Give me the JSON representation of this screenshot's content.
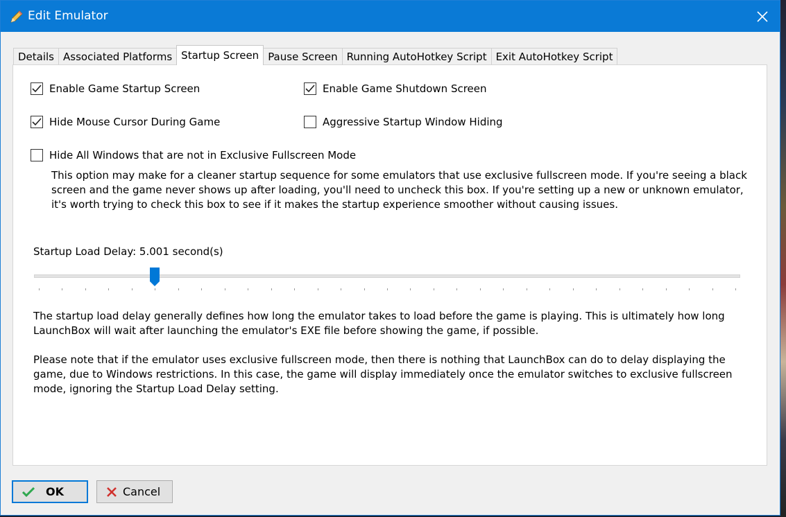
{
  "window": {
    "title": "Edit Emulator"
  },
  "tabs": [
    {
      "label": "Details"
    },
    {
      "label": "Associated Platforms"
    },
    {
      "label": "Startup Screen",
      "active": true
    },
    {
      "label": "Pause Screen"
    },
    {
      "label": "Running AutoHotkey Script"
    },
    {
      "label": "Exit AutoHotkey Script"
    }
  ],
  "startup": {
    "enable_startup": {
      "label": "Enable Game Startup Screen",
      "checked": true
    },
    "enable_shutdown": {
      "label": "Enable Game Shutdown Screen",
      "checked": true
    },
    "hide_cursor": {
      "label": "Hide Mouse Cursor During Game",
      "checked": true
    },
    "aggressive_hiding": {
      "label": "Aggressive Startup Window Hiding",
      "checked": false
    },
    "hide_windows": {
      "label": "Hide All Windows that are not in Exclusive Fullscreen Mode",
      "checked": false
    },
    "hide_windows_desc_lines": [
      "This option may make for a cleaner startup sequence for some emulators that use exclusive fullscreen mode. If you're seeing a black",
      "screen and the game never shows up after loading, you'll need to uncheck this box. If you're setting up a new or unknown emulator,",
      "it's worth trying to check this box to see if it makes the startup experience smoother without causing issues."
    ],
    "delay_label": "Startup Load Delay: 5.001 second(s)",
    "delay_slider": {
      "value": 5.001,
      "min": 0,
      "max": 30,
      "tick_count": 30
    },
    "delay_desc_lines": [
      "The startup load delay generally defines how long the emulator takes to load before the game is playing. This is ultimately how long",
      "LaunchBox will wait after launching the emulator's EXE file before showing the game, if possible."
    ],
    "note_lines": [
      "Please note that if the emulator uses exclusive fullscreen mode, then there is nothing that LaunchBox can do to delay displaying the",
      "game, due to Windows restrictions. In this case, the game will display immediately once the emulator switches to exclusive fullscreen",
      "mode, ignoring the Startup Load Delay setting."
    ]
  },
  "buttons": {
    "ok": "OK",
    "cancel": "Cancel"
  },
  "colors": {
    "titlebar": "#0a7ad6",
    "accent": "#0078d7",
    "check_green": "#2fa84f",
    "cancel_red": "#d0312d"
  }
}
